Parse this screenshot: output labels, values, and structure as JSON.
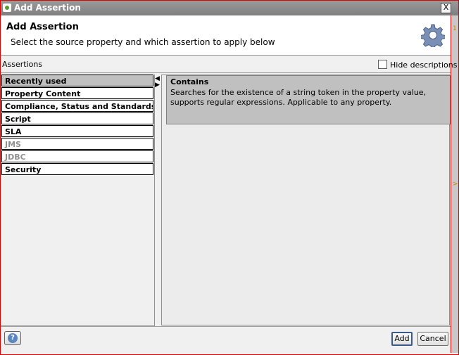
{
  "window": {
    "title": "Add Assertion",
    "close_glyph": "X"
  },
  "header": {
    "title": "Add Assertion",
    "subtitle": "Select the source property and which assertion to apply below",
    "icon": "gear-icon"
  },
  "toolbar": {
    "assertions_label": "Assertions",
    "hide_descriptions_label": "Hide descriptions",
    "hide_descriptions_checked": false
  },
  "categories": [
    {
      "label": "Recently used",
      "state": "selected"
    },
    {
      "label": "Property Content",
      "state": "normal"
    },
    {
      "label": "Compliance, Status and Standards",
      "state": "normal"
    },
    {
      "label": "Script",
      "state": "normal"
    },
    {
      "label": "SLA",
      "state": "normal"
    },
    {
      "label": "JMS",
      "state": "disabled"
    },
    {
      "label": "JDBC",
      "state": "disabled"
    },
    {
      "label": "Security",
      "state": "normal"
    }
  ],
  "assertions": [
    {
      "name": "Contains",
      "description": "Searches for the existence of a string token in the property value, supports regular expressions. Applicable to any property."
    }
  ],
  "footer": {
    "help_glyph": "?",
    "add_label": "Add",
    "cancel_label": "Cancel"
  },
  "colors": {
    "titlebar": "#8a8a8a",
    "frame_border": "#e00000",
    "selected_row": "#c0c0c0",
    "help_icon": "#5b87c0"
  }
}
